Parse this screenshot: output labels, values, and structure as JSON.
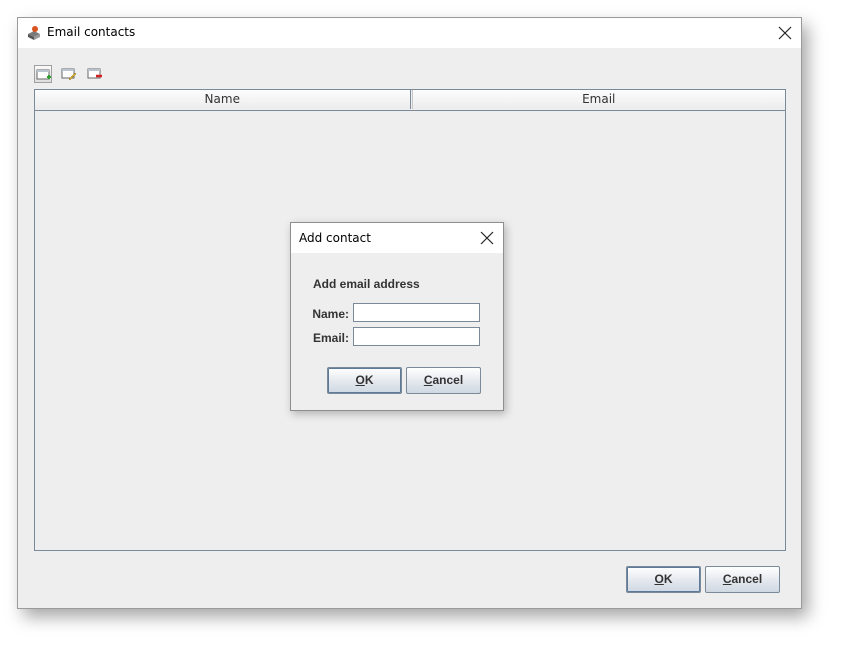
{
  "window": {
    "title": "Email contacts",
    "icon": "app-icon",
    "close_icon": "close-icon"
  },
  "toolbar": {
    "buttons": [
      {
        "icon": "add-contact-icon"
      },
      {
        "icon": "edit-contact-icon"
      },
      {
        "icon": "remove-contact-icon"
      }
    ]
  },
  "table": {
    "columns": [
      "Name",
      "Email"
    ],
    "rows": []
  },
  "dialog": {
    "title": "Add contact",
    "heading": "Add email address",
    "name_label": "Name:",
    "email_label": "Email:",
    "name_value": "",
    "email_value": "",
    "ok_mnemonic": "O",
    "ok_rest": "K",
    "cancel_mnemonic": "C",
    "cancel_rest": "ancel"
  },
  "footer": {
    "ok_mnemonic": "O",
    "ok_rest": "K",
    "cancel_mnemonic": "C",
    "cancel_rest": "ancel"
  },
  "colors": {
    "window_bg": "#eeeeee",
    "border": "#7a8a99",
    "add_accent": "#2e9e2e",
    "remove_accent": "#d42020"
  }
}
